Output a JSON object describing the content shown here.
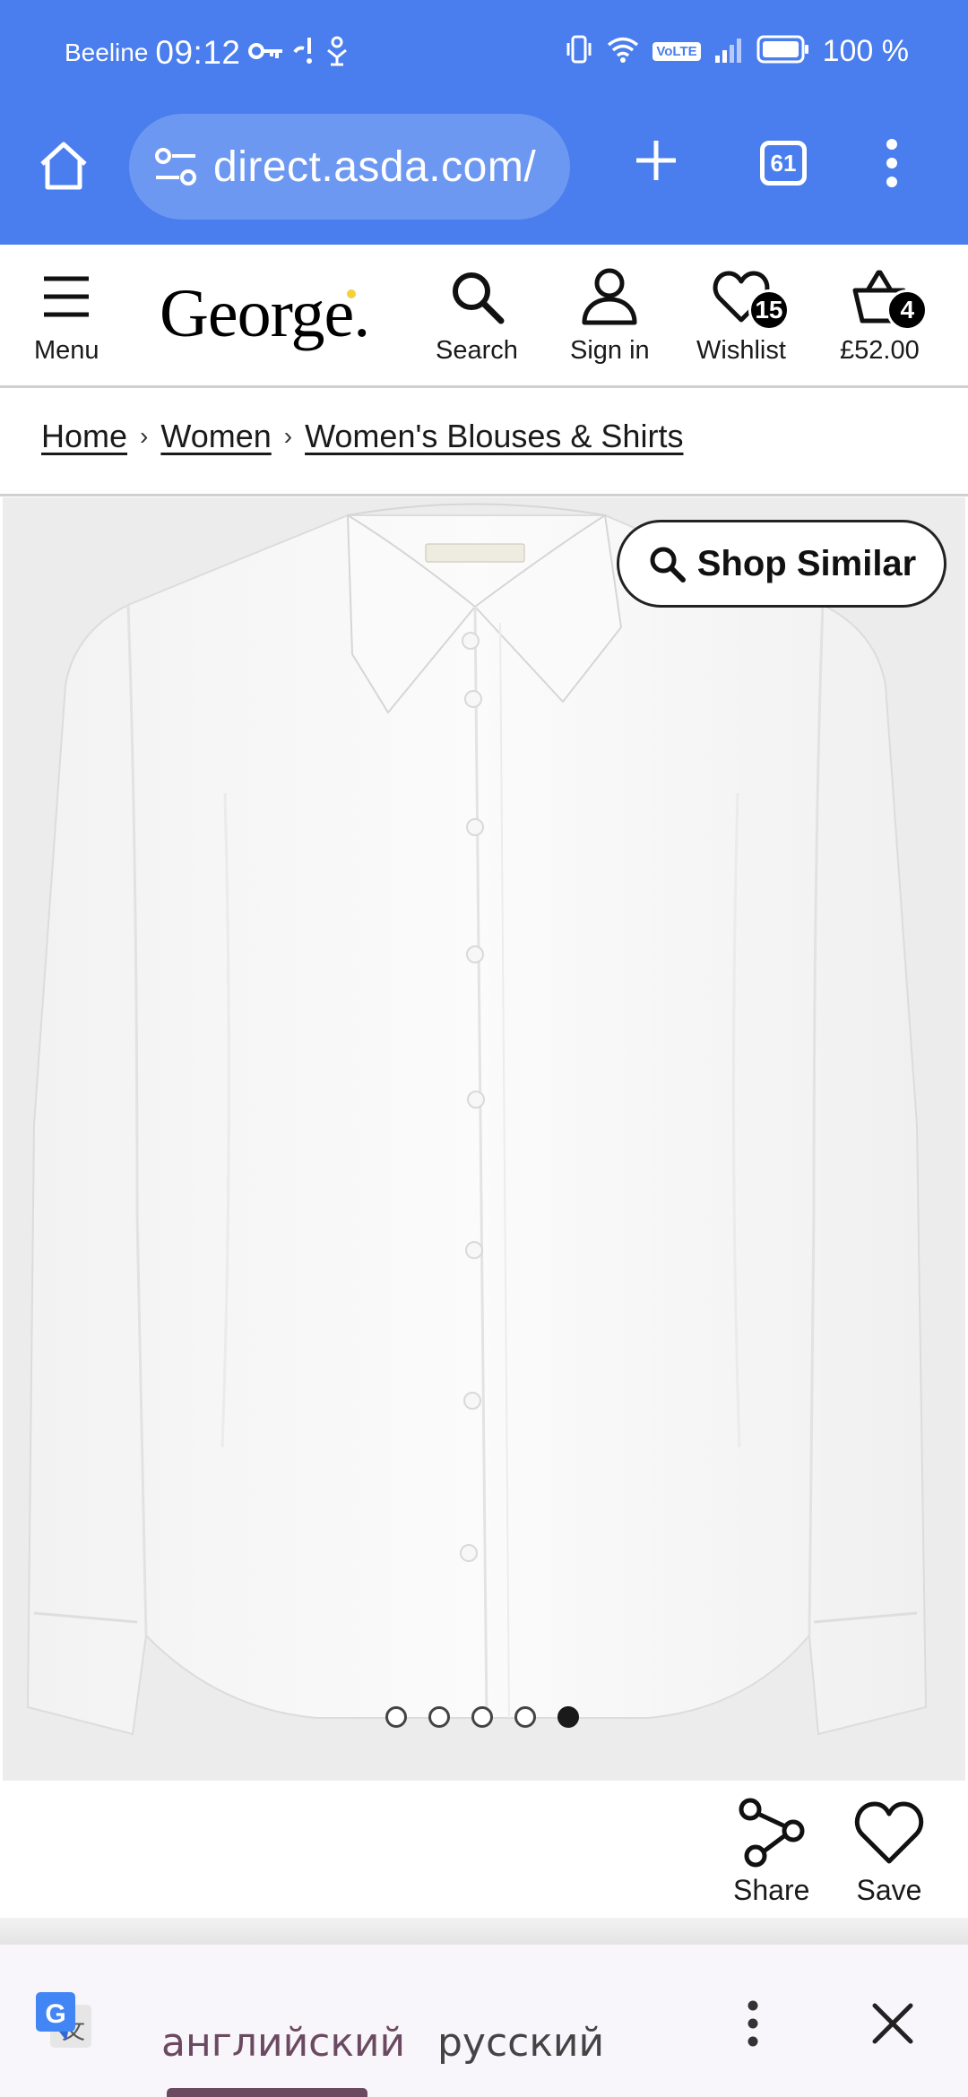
{
  "status_bar": {
    "carrier": "Beeline",
    "time": "09:12",
    "battery": "100 %",
    "volte": "VoLTE"
  },
  "browser": {
    "url": "direct.asda.com/",
    "tab_count": "61"
  },
  "header": {
    "menu_label": "Menu",
    "logo": "George.",
    "search_label": "Search",
    "signin_label": "Sign in",
    "wishlist_label": "Wishlist",
    "wishlist_count": "15",
    "basket_count": "4",
    "basket_total": "£52.00"
  },
  "breadcrumb": {
    "items": [
      "Home",
      "Women",
      "Women's Blouses & Shirts"
    ],
    "separator": "›"
  },
  "product": {
    "shop_similar_label": "Shop Similar",
    "image_count": 5,
    "active_image": 5,
    "share_label": "Share",
    "save_label": "Save"
  },
  "translate": {
    "source_lang": "английский",
    "target_lang": "русский"
  },
  "colors": {
    "browser_blue": "#4a7ded",
    "translate_accent": "#6b4a61",
    "logo_dot": "#f2d13a"
  }
}
